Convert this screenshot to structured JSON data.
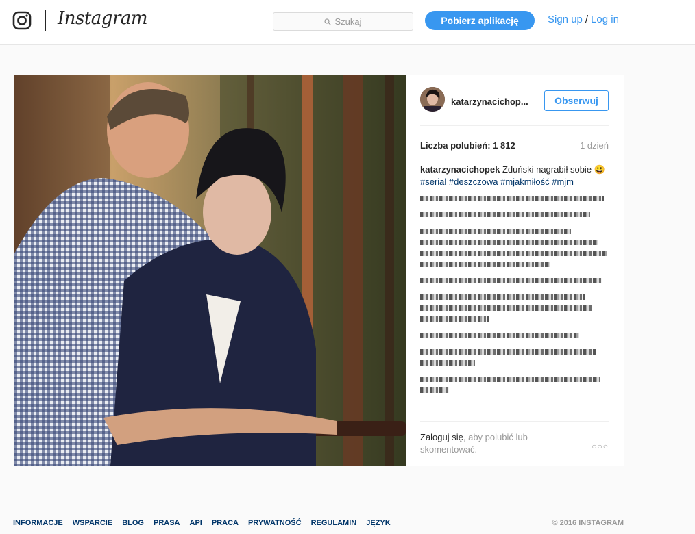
{
  "header": {
    "logo_text": "Instagram",
    "search_placeholder": "Szukaj",
    "download_label": "Pobierz aplikację",
    "signup_label": "Sign up",
    "separator": "/",
    "login_label": "Log in"
  },
  "post": {
    "username": "katarzynacichop...",
    "follow_label": "Obserwuj",
    "likes": "Liczba polubień: 1 812",
    "time": "1 dzień",
    "caption": {
      "user": "katarzynacichopek",
      "text": "Zduński nagrabił sobie",
      "emoji": "😃",
      "hashtags": [
        "#serial",
        "#deszczowa",
        "#mjakmiłość",
        "#mjm"
      ]
    },
    "login_link": "Zaloguj się",
    "login_rest": ", aby polubić lub skomentować.",
    "more_icon": "more-icon"
  },
  "footer": {
    "links": [
      "INFORMACJE",
      "WSPARCIE",
      "BLOG",
      "PRASA",
      "API",
      "PRACA",
      "PRYWATNOŚĆ",
      "REGULAMIN",
      "JĘZYK"
    ],
    "copyright": "© 2016 INSTAGRAM"
  },
  "colors": {
    "accent": "#3897f0",
    "link": "#003569",
    "muted": "#999999"
  }
}
